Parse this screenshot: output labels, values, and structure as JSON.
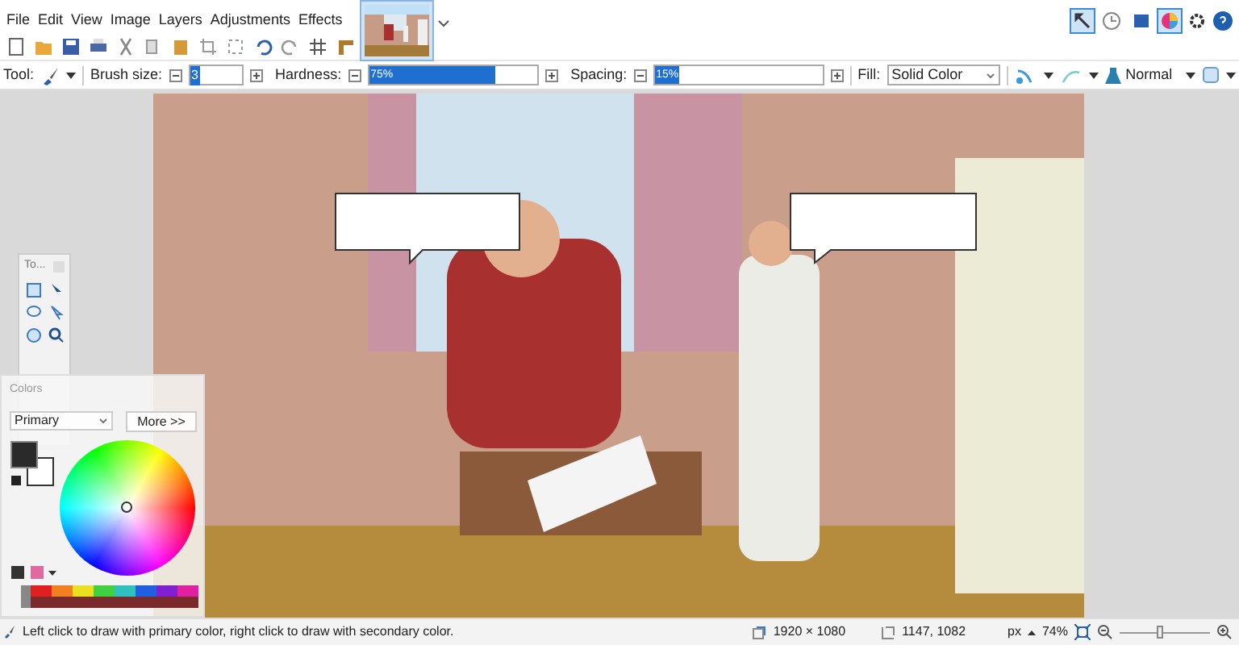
{
  "menu": [
    "File",
    "Edit",
    "View",
    "Image",
    "Layers",
    "Adjustments",
    "Effects"
  ],
  "panel_toggles": [
    {
      "kind": "tools",
      "selected": true
    },
    {
      "kind": "history",
      "selected": false
    },
    {
      "kind": "layers",
      "selected": false
    },
    {
      "kind": "colors",
      "selected": true
    }
  ],
  "toolbar": {
    "tool_label": "Tool:",
    "brush_size_label": "Brush size:",
    "brush_size": "3",
    "hardness_label": "Hardness:",
    "hardness": {
      "reading": "75%",
      "level": 0.75
    },
    "spacing_label": "Spacing:",
    "spacing": {
      "reading": "15%",
      "level": 0.15
    },
    "fill_label": "Fill:",
    "fill": "Solid Color",
    "blend_mode": "Normal"
  },
  "tools_window": {
    "title": "To..."
  },
  "colors_window": {
    "title": "Colors",
    "target": "Primary",
    "more_button": "More >>"
  },
  "status_bar": {
    "hint": "Left click to draw with primary color, right click to draw with secondary color.",
    "image_size": "1920 × 1080",
    "cursor": "1147, 1082",
    "unit": "px",
    "zoom": "74%",
    "zoom_slider": {
      "level": 0.45
    }
  }
}
